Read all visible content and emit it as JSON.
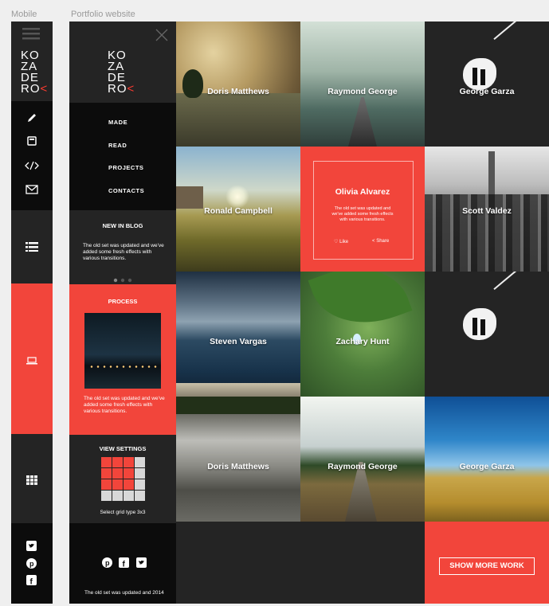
{
  "labels": {
    "mobile": "Mobile",
    "portfolio": "Portfolio website"
  },
  "logo": {
    "line1": "KO",
    "line2": "ZA",
    "line3": "DE",
    "line4": "RO",
    "accent": "<"
  },
  "menu": [
    "MADE",
    "READ",
    "PROJECTS",
    "CONTACTS"
  ],
  "blog": {
    "title": "NEW IN BLOG",
    "text": "The old set was updated and we've added some fresh effects with various transitions."
  },
  "process": {
    "title": "PROCESS",
    "text": "The old set was updated and we've added some fresh effects with various transitions."
  },
  "view_settings": {
    "title": "VIEW SETTINGS",
    "caption": "Select grid type 3x3"
  },
  "footer": {
    "text": "The old set was updated and  2014"
  },
  "tiles": [
    {
      "name": "Doris Matthews"
    },
    {
      "name": "Raymond George"
    },
    {
      "name": "George Garza"
    },
    {
      "name": "Ronald Campbell"
    },
    {
      "name": "Scott Valdez"
    },
    {
      "name": "Steven Vargas"
    },
    {
      "name": "Zachary Hunt"
    },
    {
      "name": "Doris Matthews"
    },
    {
      "name": "Raymond George"
    },
    {
      "name": "George Garza"
    }
  ],
  "featured": {
    "name": "Olivia Alvarez",
    "text": "The old set was updated and we've added some fresh effects with various transitions.",
    "like": "Like",
    "share": "Share"
  },
  "show_more": "SHOW MORE WORK",
  "icons": {
    "mobile": [
      "hamburger-icon",
      "pencil-icon",
      "book-icon",
      "code-icon",
      "mail-icon",
      "list-icon",
      "laptop-icon",
      "grid-icon",
      "twitter-icon",
      "pinterest-icon",
      "facebook-icon"
    ],
    "site": [
      "close-icon",
      "pinterest-icon",
      "facebook-icon",
      "twitter-icon"
    ]
  },
  "colors": {
    "accent": "#f2453b",
    "dark": "#242424",
    "black": "#0c0c0c",
    "mid": "#2b2b2b"
  }
}
